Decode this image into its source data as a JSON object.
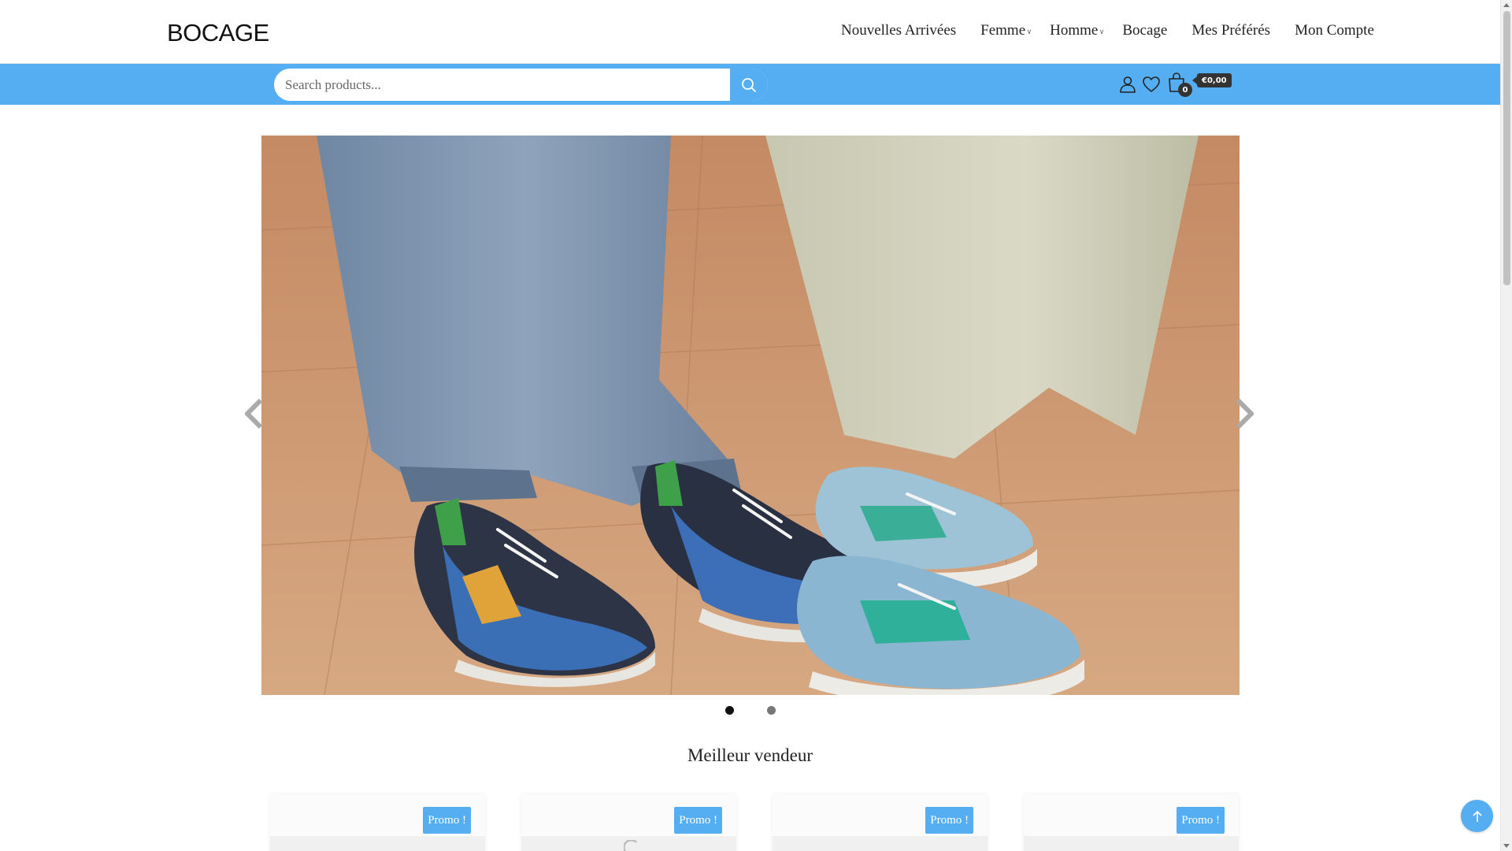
{
  "header": {
    "logo": "BOCAGE",
    "nav": [
      {
        "label": "Nouvelles Arrivées",
        "has_dropdown": false
      },
      {
        "label": "Femme",
        "has_dropdown": true
      },
      {
        "label": "Homme",
        "has_dropdown": true
      },
      {
        "label": "Bocage",
        "has_dropdown": false
      },
      {
        "label": "Mes Préférés",
        "has_dropdown": false
      },
      {
        "label": "Mon Compte",
        "has_dropdown": false
      }
    ]
  },
  "search": {
    "placeholder": "Search products...",
    "icon": "search-icon"
  },
  "toolbar_icons": [
    "user-icon",
    "heart-icon",
    "shopping-bag-icon"
  ],
  "cart": {
    "count": "0",
    "total": "€0,00"
  },
  "slider": {
    "slide_count": 2,
    "active_slide": 1,
    "prev_icon": "chevron-left-icon",
    "next_icon": "chevron-right-icon"
  },
  "section": {
    "title": "Meilleur vendeur"
  },
  "products": [
    {
      "badge": "Promo !"
    },
    {
      "badge": "Promo !"
    },
    {
      "badge": "Promo !"
    },
    {
      "badge": "Promo !"
    }
  ],
  "colors": {
    "accent": "#56aef2",
    "dark": "#333333"
  },
  "scroll_to_top_icon": "arrow-up-icon"
}
